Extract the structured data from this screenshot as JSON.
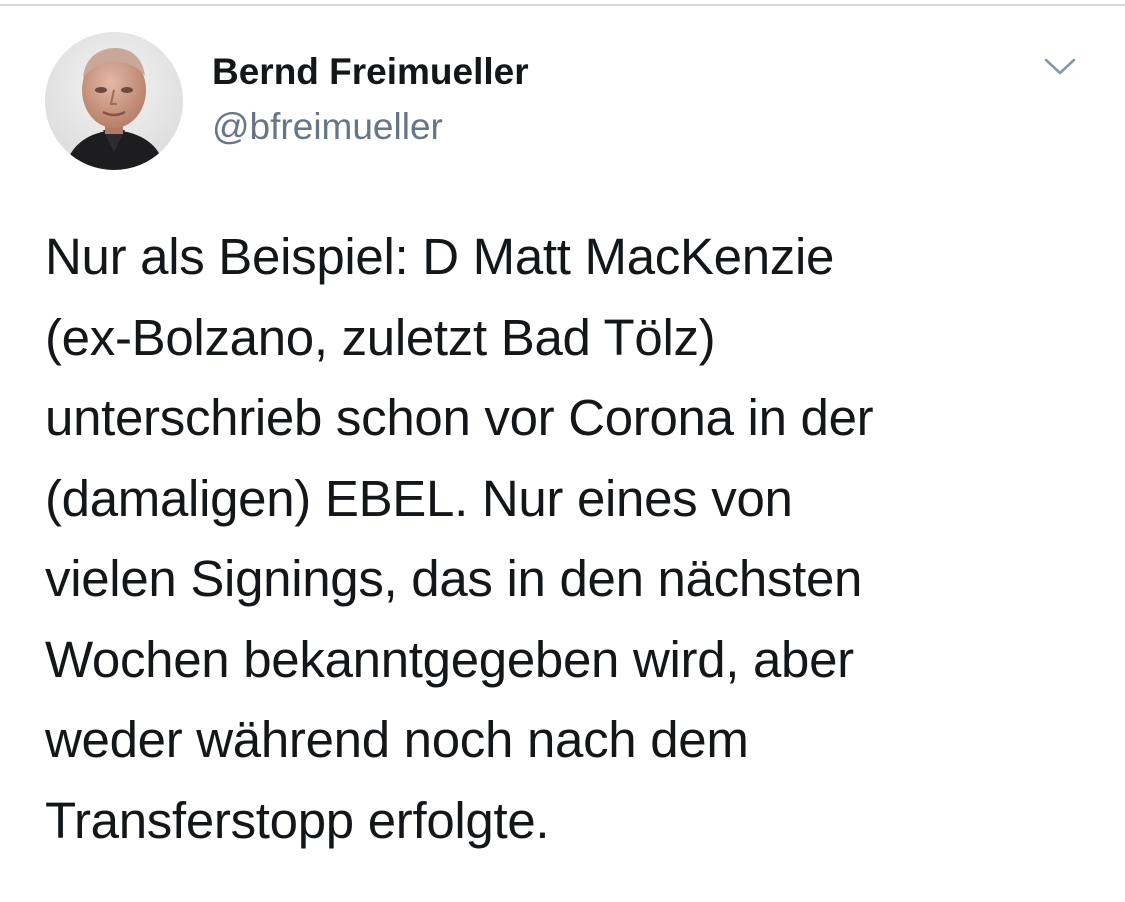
{
  "tweet": {
    "author": {
      "display_name": "Bernd Freimueller",
      "handle": "@bfreimueller",
      "avatar_icon": "profile-photo"
    },
    "more_icon": "chevron-down-icon",
    "text_lines": [
      "Nur als Beispiel: D Matt MacKenzie",
      "(ex-Bolzano, zuletzt Bad Tölz)",
      "unterschrieb schon vor Corona in der",
      "(damaligen) EBEL. Nur eines von",
      "vielen Signings, das in den nächsten",
      "Wochen bekanntgegeben wird, aber",
      "weder während noch nach dem",
      "Transferstopp erfolgte."
    ]
  },
  "colors": {
    "text_primary": "#14171a",
    "text_secondary": "#657786",
    "divider": "#d3dbe1",
    "icon": "#8899a6"
  }
}
